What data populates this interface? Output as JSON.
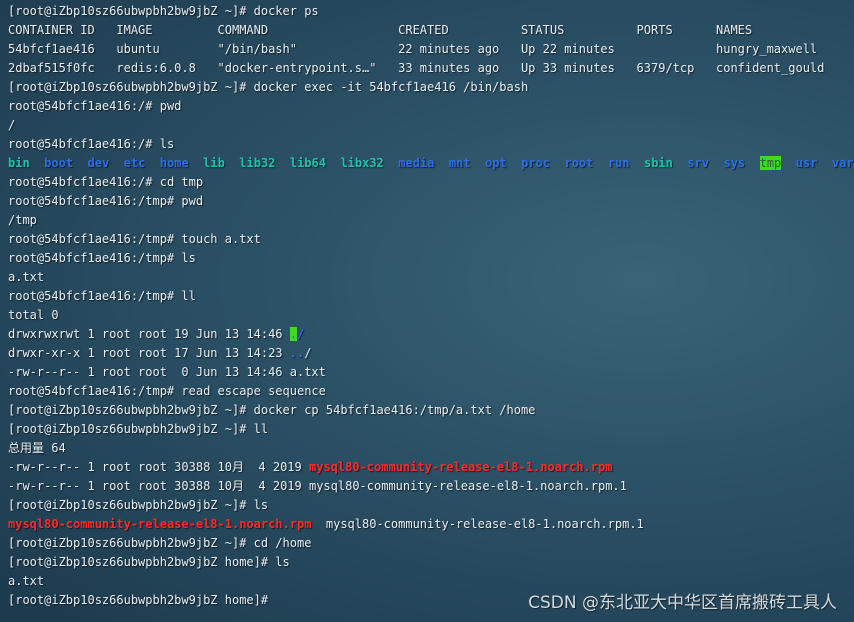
{
  "terminal": {
    "lines": [
      [
        {
          "t": "[root@iZbp10sz66ubwpbh2bw9jbZ ~]# docker ps",
          "c": ""
        }
      ],
      [
        {
          "t": "CONTAINER ID   IMAGE         COMMAND                  CREATED          STATUS          PORTS      NAMES",
          "c": ""
        }
      ],
      [
        {
          "t": "54bfcf1ae416   ubuntu        \"/bin/bash\"              22 minutes ago   Up 22 minutes              hungry_maxwell",
          "c": ""
        }
      ],
      [
        {
          "t": "2dbaf515f0fc   redis:6.0.8   \"docker-entrypoint.s…\"   33 minutes ago   Up 33 minutes   6379/tcp   confident_gould",
          "c": ""
        }
      ],
      [
        {
          "t": "[root@iZbp10sz66ubwpbh2bw9jbZ ~]# docker exec -it 54bfcf1ae416 /bin/bash",
          "c": ""
        }
      ],
      [
        {
          "t": "root@54bfcf1ae416:/# pwd",
          "c": ""
        }
      ],
      [
        {
          "t": "/",
          "c": ""
        }
      ],
      [
        {
          "t": "root@54bfcf1ae416:/# ls",
          "c": ""
        }
      ],
      [
        {
          "t": "bin",
          "c": "link"
        },
        {
          "t": "  ",
          "c": ""
        },
        {
          "t": "boot",
          "c": "dir"
        },
        {
          "t": "  ",
          "c": ""
        },
        {
          "t": "dev",
          "c": "dir"
        },
        {
          "t": "  ",
          "c": ""
        },
        {
          "t": "etc",
          "c": "dir"
        },
        {
          "t": "  ",
          "c": ""
        },
        {
          "t": "home",
          "c": "dir"
        },
        {
          "t": "  ",
          "c": ""
        },
        {
          "t": "lib",
          "c": "link"
        },
        {
          "t": "  ",
          "c": ""
        },
        {
          "t": "lib32",
          "c": "link"
        },
        {
          "t": "  ",
          "c": ""
        },
        {
          "t": "lib64",
          "c": "link"
        },
        {
          "t": "  ",
          "c": ""
        },
        {
          "t": "libx32",
          "c": "link"
        },
        {
          "t": "  ",
          "c": ""
        },
        {
          "t": "media",
          "c": "dir"
        },
        {
          "t": "  ",
          "c": ""
        },
        {
          "t": "mnt",
          "c": "dir"
        },
        {
          "t": "  ",
          "c": ""
        },
        {
          "t": "opt",
          "c": "dir"
        },
        {
          "t": "  ",
          "c": ""
        },
        {
          "t": "proc",
          "c": "dir"
        },
        {
          "t": "  ",
          "c": ""
        },
        {
          "t": "root",
          "c": "dir"
        },
        {
          "t": "  ",
          "c": ""
        },
        {
          "t": "run",
          "c": "dir"
        },
        {
          "t": "  ",
          "c": ""
        },
        {
          "t": "sbin",
          "c": "link"
        },
        {
          "t": "  ",
          "c": ""
        },
        {
          "t": "srv",
          "c": "dir"
        },
        {
          "t": "  ",
          "c": ""
        },
        {
          "t": "sys",
          "c": "dir"
        },
        {
          "t": "  ",
          "c": ""
        },
        {
          "t": "tmp",
          "c": "sticky"
        },
        {
          "t": "  ",
          "c": ""
        },
        {
          "t": "usr",
          "c": "dir"
        },
        {
          "t": "  ",
          "c": ""
        },
        {
          "t": "var",
          "c": "dir"
        }
      ],
      [
        {
          "t": "root@54bfcf1ae416:/# cd tmp",
          "c": ""
        }
      ],
      [
        {
          "t": "root@54bfcf1ae416:/tmp# pwd",
          "c": ""
        }
      ],
      [
        {
          "t": "/tmp",
          "c": ""
        }
      ],
      [
        {
          "t": "root@54bfcf1ae416:/tmp# touch a.txt",
          "c": ""
        }
      ],
      [
        {
          "t": "root@54bfcf1ae416:/tmp# ls",
          "c": ""
        }
      ],
      [
        {
          "t": "a.txt",
          "c": ""
        }
      ],
      [
        {
          "t": "root@54bfcf1ae416:/tmp# ll",
          "c": ""
        }
      ],
      [
        {
          "t": "total 0",
          "c": ""
        }
      ],
      [
        {
          "t": "drwxrwxrwt 1 root root 19 Jun 13 14:46 ",
          "c": ""
        },
        {
          "t": ".",
          "c": "cursor"
        },
        {
          "t": "/",
          "c": "dir"
        }
      ],
      [
        {
          "t": "drwxr-xr-x 1 root root 17 Jun 13 14:23 ",
          "c": ""
        },
        {
          "t": "..",
          "c": "dir"
        },
        {
          "t": "/",
          "c": ""
        }
      ],
      [
        {
          "t": "-rw-r--r-- 1 root root  0 Jun 13 14:46 a.txt",
          "c": ""
        }
      ],
      [
        {
          "t": "root@54bfcf1ae416:/tmp# read escape sequence",
          "c": ""
        }
      ],
      [
        {
          "t": "[root@iZbp10sz66ubwpbh2bw9jbZ ~]# docker cp 54bfcf1ae416:/tmp/a.txt /home",
          "c": ""
        }
      ],
      [
        {
          "t": "[root@iZbp10sz66ubwpbh2bw9jbZ ~]# ll",
          "c": ""
        }
      ],
      [
        {
          "t": "总用量 64",
          "c": ""
        }
      ],
      [
        {
          "t": "-rw-r--r-- 1 root root 30388 10月  4 2019 ",
          "c": ""
        },
        {
          "t": "mysql80-community-release-el8-1.noarch.rpm",
          "c": "rpm"
        }
      ],
      [
        {
          "t": "-rw-r--r-- 1 root root 30388 10月  4 2019 mysql80-community-release-el8-1.noarch.rpm.1",
          "c": ""
        }
      ],
      [
        {
          "t": "[root@iZbp10sz66ubwpbh2bw9jbZ ~]# ls",
          "c": ""
        }
      ],
      [
        {
          "t": "mysql80-community-release-el8-1.noarch.rpm",
          "c": "rpm"
        },
        {
          "t": "  mysql80-community-release-el8-1.noarch.rpm.1",
          "c": ""
        }
      ],
      [
        {
          "t": "[root@iZbp10sz66ubwpbh2bw9jbZ ~]# cd /home",
          "c": ""
        }
      ],
      [
        {
          "t": "[root@iZbp10sz66ubwpbh2bw9jbZ home]# ls",
          "c": ""
        }
      ],
      [
        {
          "t": "a.txt",
          "c": ""
        }
      ],
      [
        {
          "t": "[root@iZbp10sz66ubwpbh2bw9jbZ home]#",
          "c": ""
        }
      ]
    ]
  },
  "watermark": "CSDN @东北亚大中华区首席搬砖工具人",
  "colors": {
    "directory": "#2f6fe6",
    "symlink": "#1fc4ae",
    "sticky_bg": "#3ddc20",
    "archive": "#ff2a2a",
    "text": "#e8eef2"
  }
}
